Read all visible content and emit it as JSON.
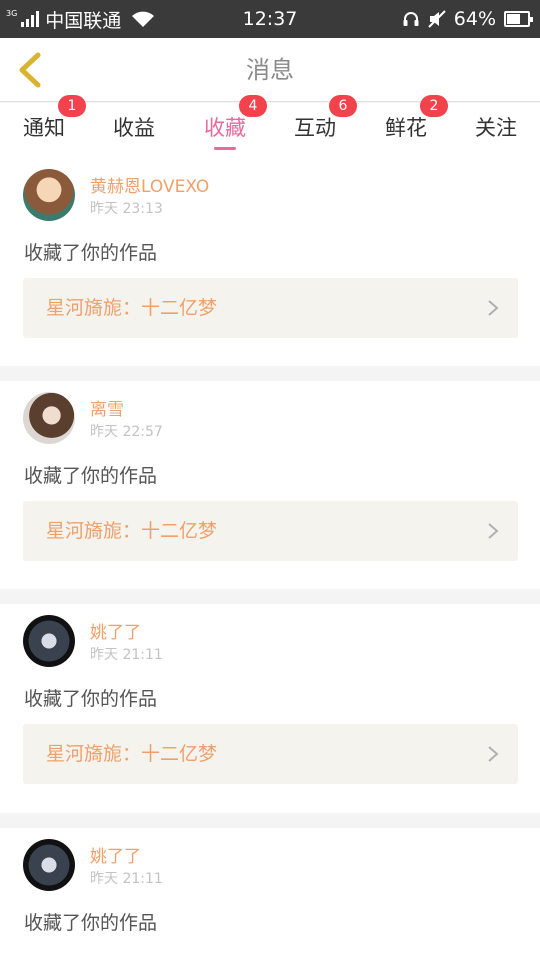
{
  "status_bar": {
    "network": "3G",
    "carrier": "中国联通",
    "time": "12:37",
    "battery_text": "64%",
    "battery_level": 0.64,
    "icons": [
      "signal-icon",
      "wifi-icon",
      "headset-icon",
      "mute-icon",
      "battery-icon"
    ]
  },
  "header": {
    "title": "消息",
    "back_icon": "chevron-left-icon"
  },
  "tabs": [
    {
      "label": "通知",
      "badge": "1"
    },
    {
      "label": "收益",
      "badge": null
    },
    {
      "label": "收藏",
      "badge": "4",
      "active": true
    },
    {
      "label": "互动",
      "badge": "6"
    },
    {
      "label": "鲜花",
      "badge": "2"
    },
    {
      "label": "关注",
      "badge": null
    }
  ],
  "messages": [
    {
      "user": "黄赫恩LOVEXO",
      "time": "昨天 23:13",
      "action": "收藏了你的作品",
      "work": "星河旖旎：十二亿梦"
    },
    {
      "user": "离雪",
      "time": "昨天 22:57",
      "action": "收藏了你的作品",
      "work": "星河旖旎：十二亿梦"
    },
    {
      "user": "姚了了",
      "time": "昨天 21:11",
      "action": "收藏了你的作品",
      "work": "星河旖旎：十二亿梦"
    },
    {
      "user": "姚了了",
      "time": "昨天 21:11",
      "action": "收藏了你的作品",
      "work": ""
    }
  ],
  "colors": {
    "accent": "#e86aa0",
    "username": "#f0a06a",
    "badge": "#f2434d",
    "back_arrow": "#d9b430",
    "card_bg": "#f4f3ee"
  }
}
